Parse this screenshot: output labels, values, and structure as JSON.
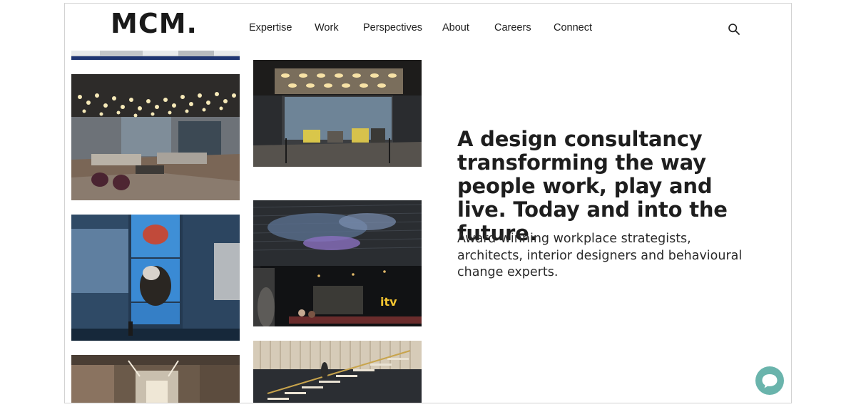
{
  "brand": {
    "logo": "MCM."
  },
  "nav": {
    "items": [
      {
        "label": "Expertise"
      },
      {
        "label": "Work"
      },
      {
        "label": "Perspectives"
      },
      {
        "label": "About"
      },
      {
        "label": "Careers"
      },
      {
        "label": "Connect"
      }
    ]
  },
  "icons": {
    "search": "search-icon",
    "chat": "chat-bubble-icon"
  },
  "hero": {
    "headline": "A design consultancy transforming the way people work, play and live. Today and into the future.",
    "subline": "Award-winning workplace strategists, architects, interior designers and behavioural change experts."
  },
  "gallery": {
    "tiles": [
      {
        "subject": "office-corridor-strip"
      },
      {
        "subject": "reception-lounge-pendant-lights"
      },
      {
        "subject": "meeting-room-lounge"
      },
      {
        "subject": "atrium-video-wall"
      },
      {
        "subject": "itv-reception"
      },
      {
        "subject": "timber-office-interior"
      },
      {
        "subject": "stair-with-timber-screen"
      }
    ],
    "itv_mark": "itv"
  },
  "colors": {
    "chat": "#6ab4ac",
    "text": "#1e1e1e",
    "border": "#d2d2d2"
  }
}
